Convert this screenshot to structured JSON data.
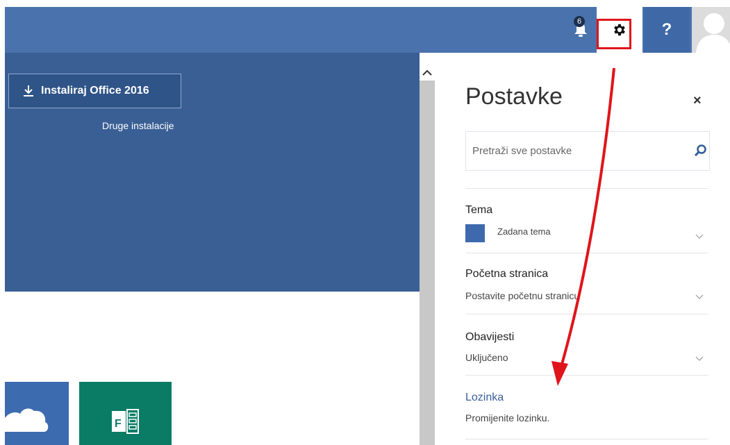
{
  "topbar": {
    "notification_count": "6",
    "help_label": "?"
  },
  "hero": {
    "install_button_label": "Instaliraj Office 2016",
    "other_installs_label": "Druge instalacije"
  },
  "settings": {
    "title": "Postavke",
    "close_label": "×",
    "search_placeholder": "Pretraži sve postavke",
    "sections": [
      {
        "title": "Tema",
        "subtitle": "Zadana tema"
      },
      {
        "title": "Početna stranica",
        "subtitle": "Postavite početnu stranicu"
      },
      {
        "title": "Obavijesti",
        "subtitle": "Uključeno"
      },
      {
        "title": "Lozinka",
        "subtitle": "Promijenite lozinku."
      }
    ]
  },
  "colors": {
    "topbar": "#4a72ac",
    "hero": "#3a5f95",
    "annotation": "#e0141b",
    "link": "#3a5f98"
  }
}
